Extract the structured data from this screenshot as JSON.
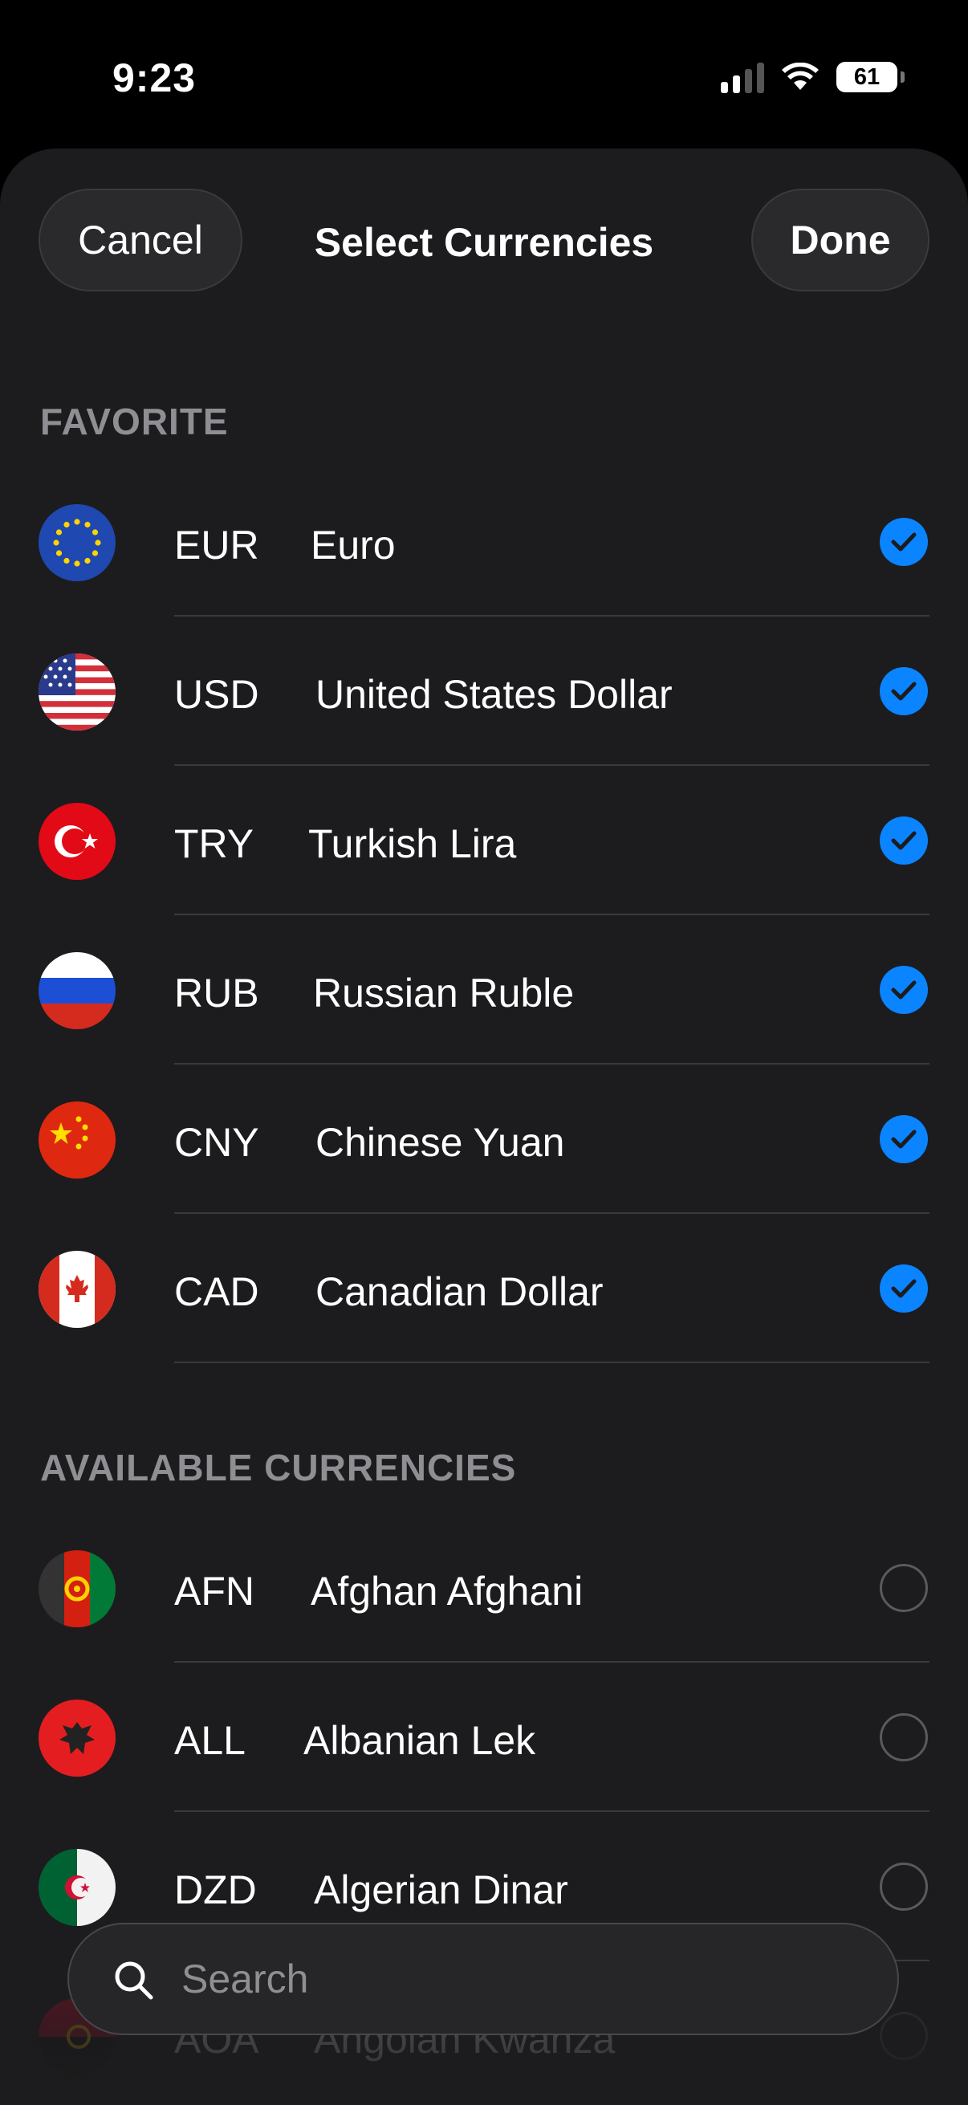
{
  "status_bar": {
    "time": "9:23",
    "battery": "61",
    "icons": [
      "signal-icon",
      "wifi-icon",
      "battery-icon"
    ]
  },
  "nav": {
    "cancel_label": "Cancel",
    "title": "Select Currencies",
    "done_label": "Done"
  },
  "favorite": {
    "header": "FAVORITE",
    "items": [
      {
        "code": "EUR",
        "name": "Euro",
        "selected": true
      },
      {
        "code": "USD",
        "name": "United States Dollar",
        "selected": true
      },
      {
        "code": "TRY",
        "name": "Turkish Lira",
        "selected": true
      },
      {
        "code": "RUB",
        "name": "Russian Ruble",
        "selected": true
      },
      {
        "code": "CNY",
        "name": "Chinese Yuan",
        "selected": true
      },
      {
        "code": "CAD",
        "name": "Canadian Dollar",
        "selected": true
      }
    ]
  },
  "available": {
    "header": "AVAILABLE CURRENCIES",
    "items": [
      {
        "code": "AFN",
        "name": "Afghan Afghani",
        "selected": false
      },
      {
        "code": "ALL",
        "name": "Albanian Lek",
        "selected": false
      },
      {
        "code": "DZD",
        "name": "Algerian Dinar",
        "selected": false
      },
      {
        "code": "AOA",
        "name": "Angolan Kwanza",
        "selected": false
      }
    ]
  },
  "search": {
    "placeholder": "Search"
  },
  "colors": {
    "accent": "#0a84ff",
    "sheet_background": "#1c1c1e",
    "secondary_text": "#8e8e93"
  }
}
